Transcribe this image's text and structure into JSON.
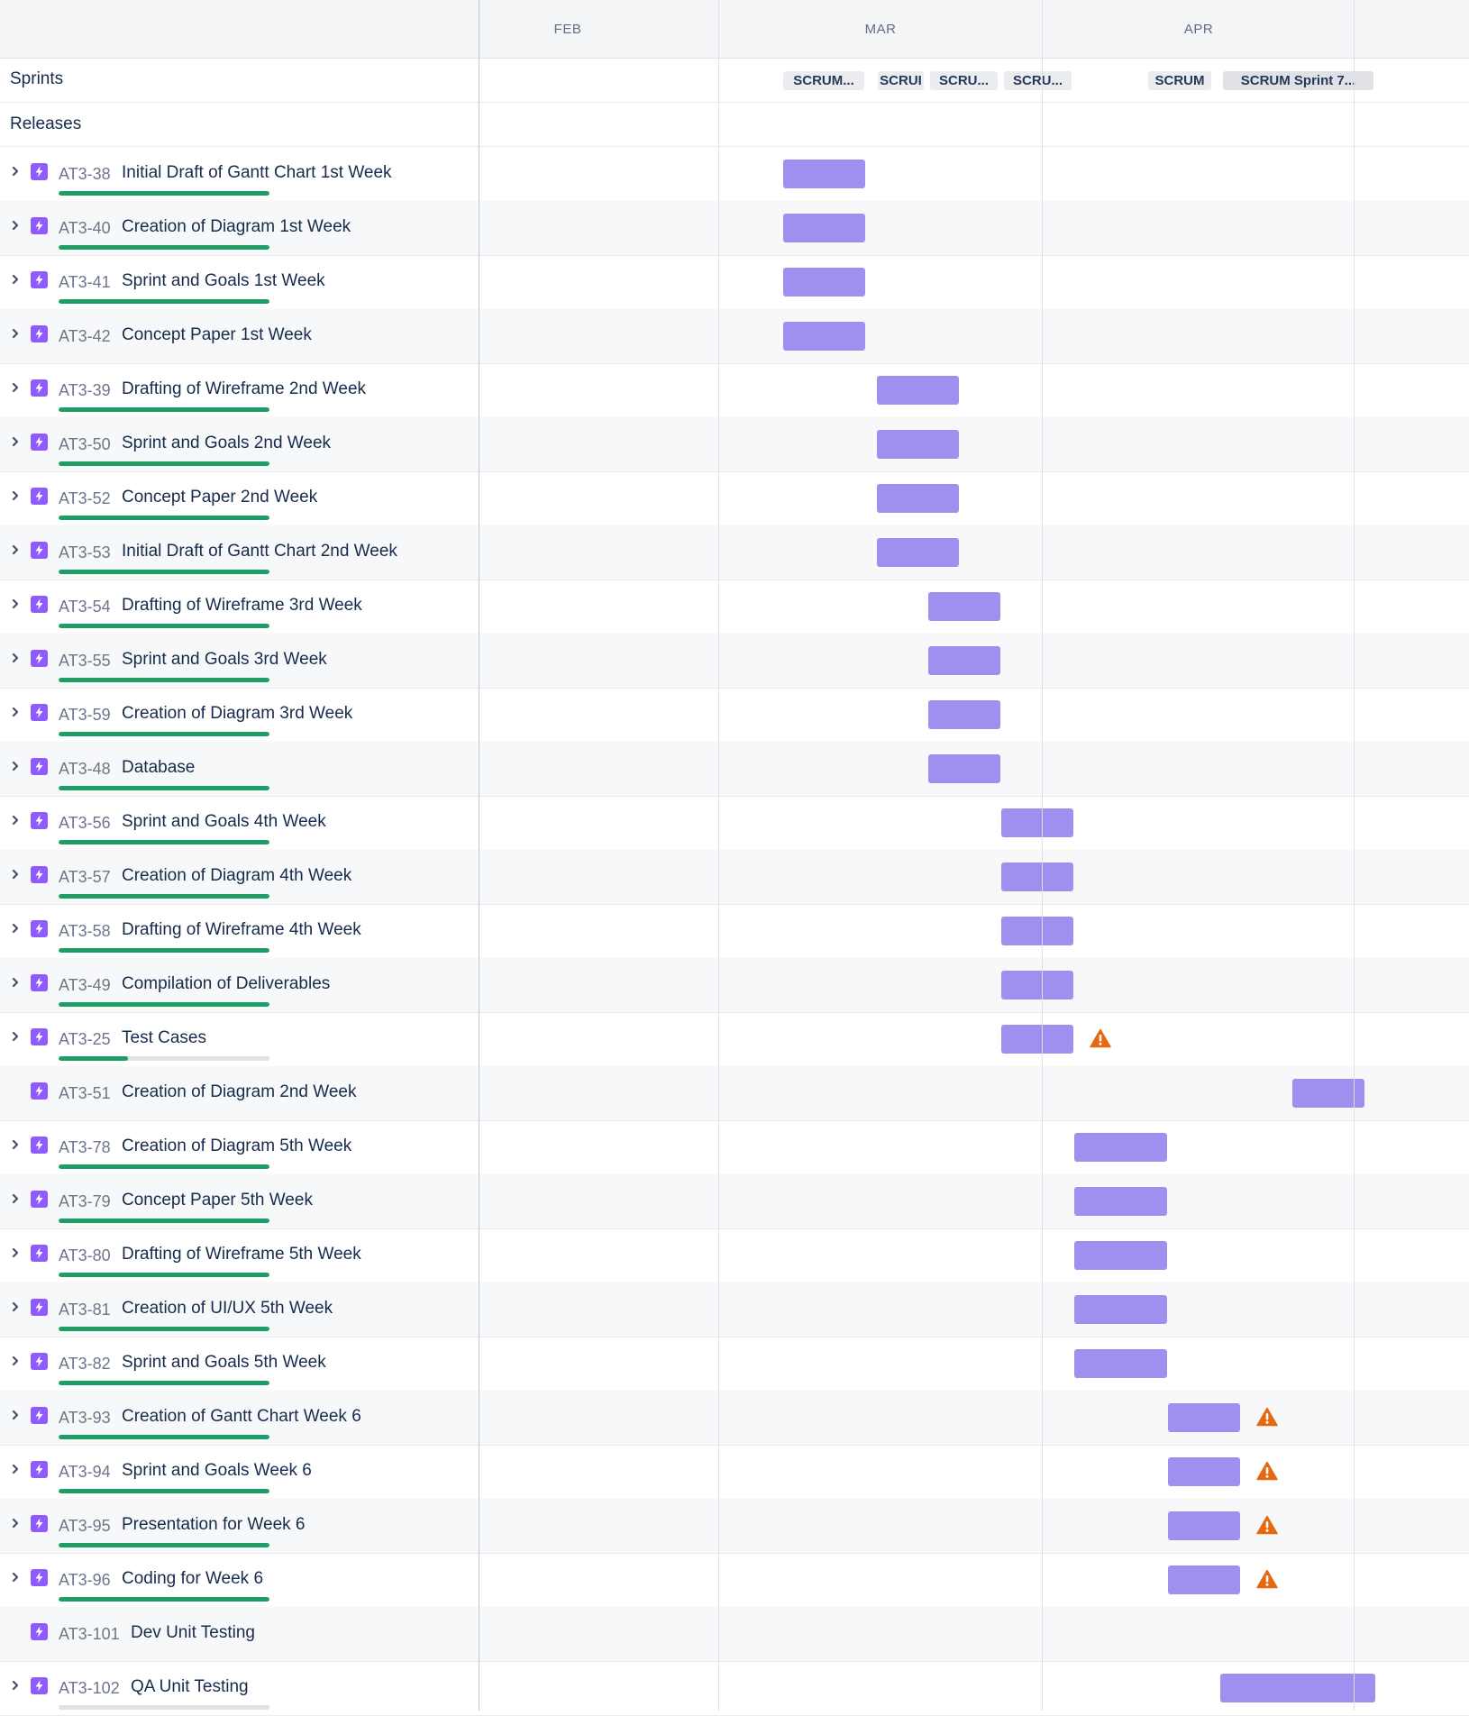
{
  "months": [
    "FEB",
    "MAR",
    "APR"
  ],
  "meta_rows": {
    "sprints": "Sprints",
    "releases": "Releases"
  },
  "sprints": [
    {
      "label": "SCRUM...",
      "active": false
    },
    {
      "label": "SCRUI",
      "active": false
    },
    {
      "label": "SCRU...",
      "active": false
    },
    {
      "label": "SCRU...",
      "active": false
    },
    {
      "label": "SCRUM",
      "active": false
    },
    {
      "label": "SCRUM Sprint 7...",
      "active": true
    }
  ],
  "issues": [
    {
      "key": "AT3-38",
      "title": "Initial Draft of Gantt Chart 1st Week",
      "expandable": true,
      "progress": 1.0,
      "warning": false
    },
    {
      "key": "AT3-40",
      "title": "Creation of Diagram 1st Week",
      "expandable": true,
      "progress": 1.0,
      "warning": false
    },
    {
      "key": "AT3-41",
      "title": "Sprint and Goals 1st Week",
      "expandable": true,
      "progress": 1.0,
      "warning": false
    },
    {
      "key": "AT3-42",
      "title": "Concept Paper 1st Week",
      "expandable": true,
      "progress": null,
      "warning": false
    },
    {
      "key": "AT3-39",
      "title": "Drafting of Wireframe 2nd Week",
      "expandable": true,
      "progress": 1.0,
      "warning": false
    },
    {
      "key": "AT3-50",
      "title": "Sprint and Goals 2nd Week",
      "expandable": true,
      "progress": 1.0,
      "warning": false
    },
    {
      "key": "AT3-52",
      "title": "Concept Paper 2nd Week",
      "expandable": true,
      "progress": 1.0,
      "warning": false
    },
    {
      "key": "AT3-53",
      "title": "Initial Draft of Gantt Chart 2nd Week",
      "expandable": true,
      "progress": 1.0,
      "warning": false
    },
    {
      "key": "AT3-54",
      "title": "Drafting of Wireframe 3rd Week",
      "expandable": true,
      "progress": 1.0,
      "warning": false
    },
    {
      "key": "AT3-55",
      "title": "Sprint and Goals 3rd Week",
      "expandable": true,
      "progress": 1.0,
      "warning": false
    },
    {
      "key": "AT3-59",
      "title": "Creation of Diagram 3rd Week",
      "expandable": true,
      "progress": 1.0,
      "warning": false
    },
    {
      "key": "AT3-48",
      "title": "Database",
      "expandable": true,
      "progress": 1.0,
      "warning": false
    },
    {
      "key": "AT3-56",
      "title": "Sprint and Goals 4th Week",
      "expandable": true,
      "progress": 1.0,
      "warning": false
    },
    {
      "key": "AT3-57",
      "title": "Creation of Diagram 4th Week",
      "expandable": true,
      "progress": 1.0,
      "warning": false
    },
    {
      "key": "AT3-58",
      "title": "Drafting of Wireframe 4th Week",
      "expandable": true,
      "progress": 1.0,
      "warning": false
    },
    {
      "key": "AT3-49",
      "title": "Compilation of Deliverables",
      "expandable": true,
      "progress": 1.0,
      "warning": false
    },
    {
      "key": "AT3-25",
      "title": "Test Cases",
      "expandable": true,
      "progress": 0.33,
      "warning": true
    },
    {
      "key": "AT3-51",
      "title": "Creation of Diagram 2nd Week",
      "expandable": false,
      "progress": null,
      "warning": false
    },
    {
      "key": "AT3-78",
      "title": "Creation of Diagram 5th Week",
      "expandable": true,
      "progress": 1.0,
      "warning": false
    },
    {
      "key": "AT3-79",
      "title": "Concept Paper 5th Week",
      "expandable": true,
      "progress": 1.0,
      "warning": false
    },
    {
      "key": "AT3-80",
      "title": "Drafting of Wireframe 5th Week",
      "expandable": true,
      "progress": 1.0,
      "warning": false
    },
    {
      "key": "AT3-81",
      "title": "Creation of UI/UX 5th Week",
      "expandable": true,
      "progress": 1.0,
      "warning": false
    },
    {
      "key": "AT3-82",
      "title": "Sprint and Goals 5th Week",
      "expandable": true,
      "progress": 1.0,
      "warning": false
    },
    {
      "key": "AT3-93",
      "title": "Creation of Gantt Chart Week 6",
      "expandable": true,
      "progress": 1.0,
      "warning": true
    },
    {
      "key": "AT3-94",
      "title": "Sprint and Goals Week 6",
      "expandable": true,
      "progress": 1.0,
      "warning": true
    },
    {
      "key": "AT3-95",
      "title": "Presentation for Week 6",
      "expandable": true,
      "progress": 1.0,
      "warning": true
    },
    {
      "key": "AT3-96",
      "title": "Coding for Week 6",
      "expandable": true,
      "progress": 1.0,
      "warning": true
    },
    {
      "key": "AT3-101",
      "title": "Dev Unit Testing",
      "expandable": false,
      "progress": null,
      "warning": false
    },
    {
      "key": "AT3-102",
      "title": "QA Unit Testing",
      "expandable": true,
      "progress": 0.0,
      "warning": false
    }
  ],
  "colors": {
    "bar": "#9f8fef",
    "progress_done": "#1f9d66",
    "progress_track": "#dfe1e6",
    "epic_icon": "#8f5bff",
    "warning": "#e56910"
  }
}
